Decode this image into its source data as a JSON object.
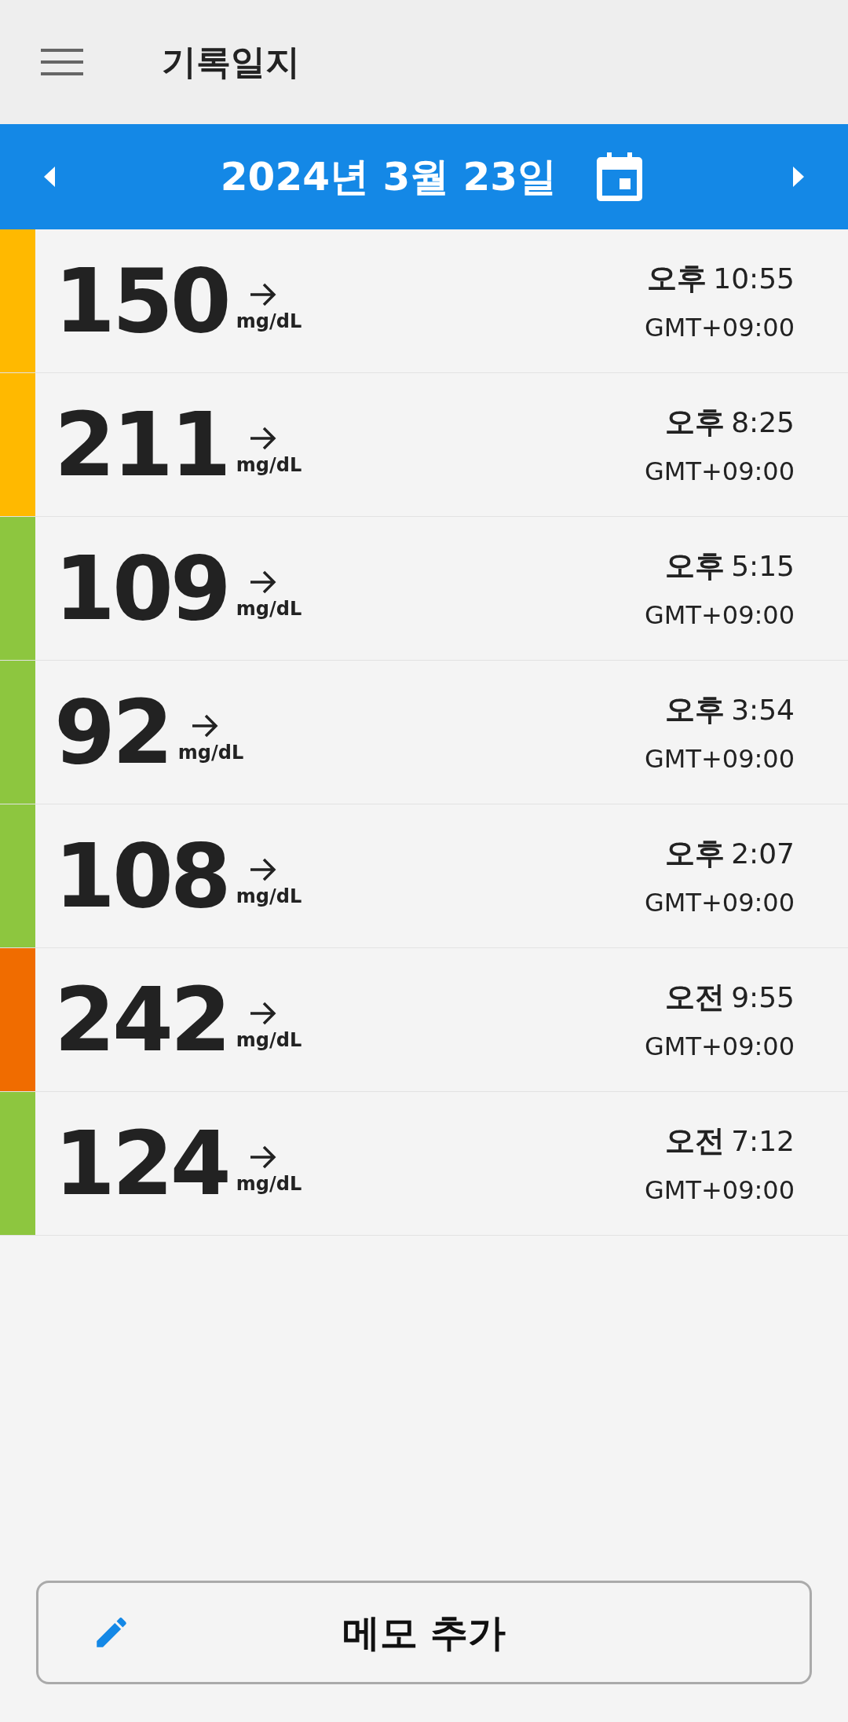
{
  "header": {
    "title": "기록일지"
  },
  "date_bar": {
    "date": "2024년 3월 23일"
  },
  "readings": [
    {
      "value": "150",
      "unit": "mg/dL",
      "period": "오후",
      "time": "10:55",
      "timezone": "GMT+09:00",
      "color": "#ffb900"
    },
    {
      "value": "211",
      "unit": "mg/dL",
      "period": "오후",
      "time": "8:25",
      "timezone": "GMT+09:00",
      "color": "#ffb900"
    },
    {
      "value": "109",
      "unit": "mg/dL",
      "period": "오후",
      "time": "5:15",
      "timezone": "GMT+09:00",
      "color": "#8dc63f"
    },
    {
      "value": "92",
      "unit": "mg/dL",
      "period": "오후",
      "time": "3:54",
      "timezone": "GMT+09:00",
      "color": "#8dc63f"
    },
    {
      "value": "108",
      "unit": "mg/dL",
      "period": "오후",
      "time": "2:07",
      "timezone": "GMT+09:00",
      "color": "#8dc63f"
    },
    {
      "value": "242",
      "unit": "mg/dL",
      "period": "오전",
      "time": "9:55",
      "timezone": "GMT+09:00",
      "color": "#f06c00"
    },
    {
      "value": "124",
      "unit": "mg/dL",
      "period": "오전",
      "time": "7:12",
      "timezone": "GMT+09:00",
      "color": "#8dc63f"
    }
  ],
  "add_note_button": {
    "label": "메모 추가"
  }
}
